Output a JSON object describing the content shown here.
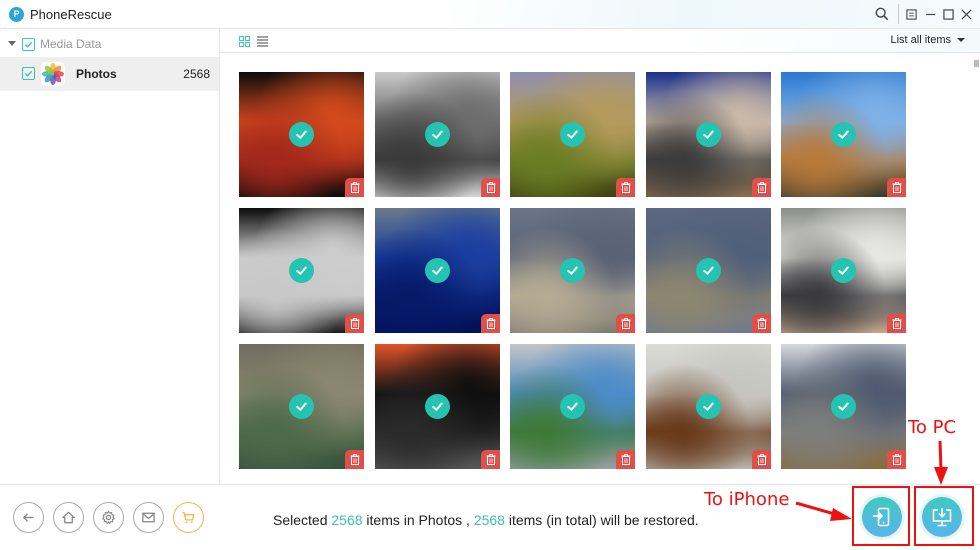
{
  "app": {
    "title": "PhoneRescue",
    "logo_letter": "P"
  },
  "titlebar": {
    "icons": [
      "search-icon",
      "menu-icon",
      "minimize-icon",
      "maximize-icon",
      "close-icon"
    ]
  },
  "sidebar": {
    "category": {
      "label": "Media Data",
      "checked": true,
      "expanded": true
    },
    "items": [
      {
        "label": "Photos",
        "count": "2568",
        "checked": true,
        "icon": "photos-app-icon"
      }
    ]
  },
  "toolbar": {
    "views": [
      {
        "name": "grid-view",
        "active": true
      },
      {
        "name": "list-view",
        "active": false
      }
    ],
    "filter_label": "List all items"
  },
  "grid": {
    "tiles": [
      {
        "subject": "orange canyon",
        "colors": [
          "#0b0b0b",
          "#d24a1c",
          "#a3281c",
          "#0b0b0b"
        ],
        "selected": true
      },
      {
        "subject": "staircase",
        "colors": [
          "#c9c9c9",
          "#6d6d6d",
          "#3a3a3a",
          "#d6d6d6"
        ],
        "selected": true
      },
      {
        "subject": "tree-lined field",
        "colors": [
          "#8e8fb0",
          "#b59a5c",
          "#6c7d25",
          "#3d4010"
        ],
        "selected": true
      },
      {
        "subject": "laptop on desk",
        "colors": [
          "#18308e",
          "#c9b8a8",
          "#3c3c3c",
          "#8b6e4f"
        ],
        "selected": true
      },
      {
        "subject": "canal houses",
        "colors": [
          "#2b79d1",
          "#7fb1e7",
          "#b77a3b",
          "#3c3b2e"
        ],
        "selected": true
      },
      {
        "subject": "presenting woman",
        "colors": [
          "#0b0b0b",
          "#cdcdcd",
          "#c8c8c8",
          "#1b1b1b"
        ],
        "selected": true
      },
      {
        "subject": "jellyfish",
        "colors": [
          "#6a7a8a",
          "#1a3ea0",
          "#061a6a",
          "#03105a"
        ],
        "selected": true
      },
      {
        "subject": "mountain lake",
        "colors": [
          "#6c7487",
          "#5a6276",
          "#b4ab93",
          "#7f7c72"
        ],
        "selected": true
      },
      {
        "subject": "lake with trees",
        "colors": [
          "#5c6880",
          "#51607a",
          "#8d8670",
          "#6e7a8e"
        ],
        "selected": true
      },
      {
        "subject": "keyboard and phone",
        "colors": [
          "#8b8d88",
          "#e6e6e2",
          "#3a3a3e",
          "#c5a88e"
        ],
        "selected": true
      },
      {
        "subject": "pine trees",
        "colors": [
          "#6f6d5e",
          "#8a8670",
          "#4e6a4a",
          "#36513a"
        ],
        "selected": true
      },
      {
        "subject": "car interior",
        "colors": [
          "#e1542a",
          "#101010",
          "#2a2a2a",
          "#585858"
        ],
        "selected": true
      },
      {
        "subject": "coastal path",
        "colors": [
          "#c5c5c5",
          "#4d8cc7",
          "#3f7a3a",
          "#9aa0a8"
        ],
        "selected": true
      },
      {
        "subject": "photo in hand",
        "colors": [
          "#dadad6",
          "#c6c6c0",
          "#6a3a1c",
          "#b8b8b0"
        ],
        "selected": true
      },
      {
        "subject": "mountain meadow",
        "colors": [
          "#d5d8dc",
          "#4f5a70",
          "#7d7e7c",
          "#8a6a3a"
        ],
        "selected": true
      }
    ]
  },
  "bottom": {
    "nav_buttons": [
      {
        "name": "back-button",
        "icon": "arrow-left-icon"
      },
      {
        "name": "home-button",
        "icon": "home-icon"
      },
      {
        "name": "settings-button",
        "icon": "gear-icon"
      },
      {
        "name": "feedback-button",
        "icon": "mail-icon"
      },
      {
        "name": "store-button",
        "icon": "cart-icon"
      }
    ],
    "status": {
      "prefix": "Selected ",
      "count_in_category": "2568",
      "middle": " items in Photos , ",
      "count_total": "2568",
      "suffix": " items (in total) will be restored."
    },
    "actions": [
      {
        "name": "to-device-button",
        "icon": "phone-import-icon"
      },
      {
        "name": "to-computer-button",
        "icon": "monitor-download-icon"
      }
    ]
  },
  "annotations": {
    "to_iphone": "To iPhone",
    "to_pc": "To PC",
    "color": "#ee1111"
  },
  "colors": {
    "accent": "#3bc6bb",
    "check_badge": "#25c3b1",
    "delete_badge": "#e0504b",
    "cart": "#f7b548"
  }
}
